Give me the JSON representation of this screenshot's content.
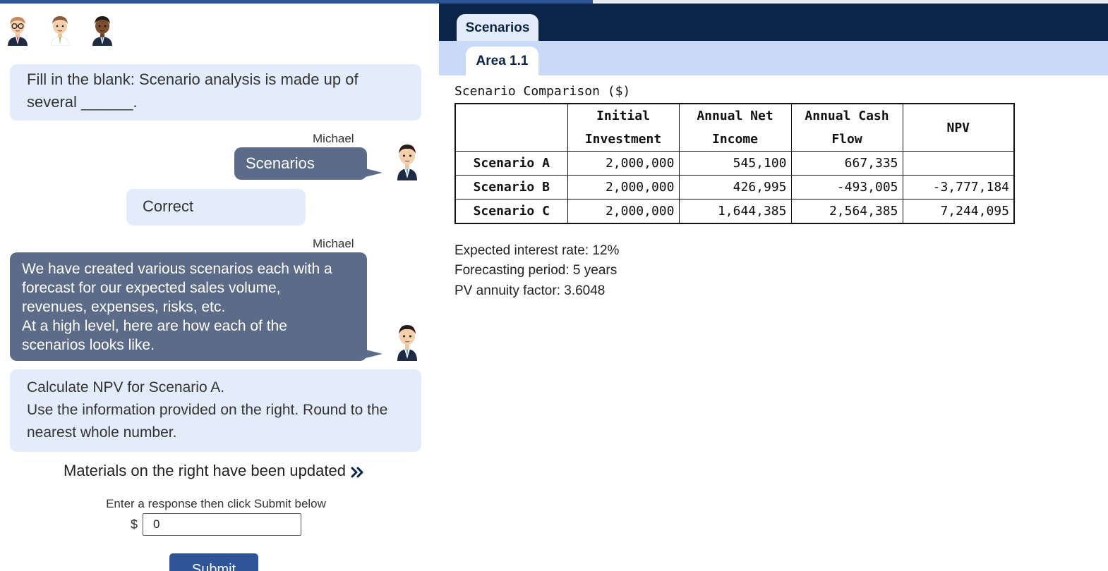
{
  "progress": {
    "fraction": 0.535
  },
  "avatars": [
    {
      "name": "avatar-1"
    },
    {
      "name": "avatar-2"
    },
    {
      "name": "avatar-3"
    }
  ],
  "chat": {
    "question1": "Fill in the blank: Scenario analysis is made up of several ______.",
    "speaker1": "Michael",
    "user_answer": "Scenarios",
    "feedback": "Correct",
    "speaker2": "Michael",
    "message2_lines": [
      "We have created various scenarios each with a",
      "forecast for our expected sales volume,",
      "revenues, expenses, risks, etc.",
      "At a high level, here are how each of the",
      "scenarios looks like."
    ],
    "question2_line1": "Calculate NPV for Scenario A.",
    "question2_line2": "Use the information provided on the right. Round to the nearest whole number.",
    "materials_notice": "Materials on the right have been updated",
    "response_prompt": "Enter a response then click Submit below",
    "currency_symbol": "$",
    "response_value": "0",
    "submit_label": "Submit"
  },
  "tabs": {
    "main": "Scenarios",
    "sub": "Area 1.1"
  },
  "table": {
    "caption": "Scenario Comparison ($)",
    "headers": [
      "",
      "Initial Investment",
      "Annual Net Income",
      "Annual Cash Flow",
      "NPV"
    ],
    "rows": [
      {
        "label": "Scenario A",
        "initial": "2,000,000",
        "net_income": "545,100",
        "cash_flow": "667,335",
        "npv": ""
      },
      {
        "label": "Scenario B",
        "initial": "2,000,000",
        "net_income": "426,995",
        "cash_flow": "-493,005",
        "npv": "-3,777,184"
      },
      {
        "label": "Scenario C",
        "initial": "2,000,000",
        "net_income": "1,644,385",
        "cash_flow": "2,564,385",
        "npv": "7,244,095"
      }
    ]
  },
  "info": {
    "interest_rate": "Expected interest rate: 12%",
    "period": "Forecasting period: 5 years",
    "annuity": "PV annuity factor: 3.6048"
  },
  "colors": {
    "accent": "#2e5597",
    "navy": "#0b2447",
    "bubble_light": "#e3ecfb",
    "bubble_dark": "#5c6b88"
  }
}
